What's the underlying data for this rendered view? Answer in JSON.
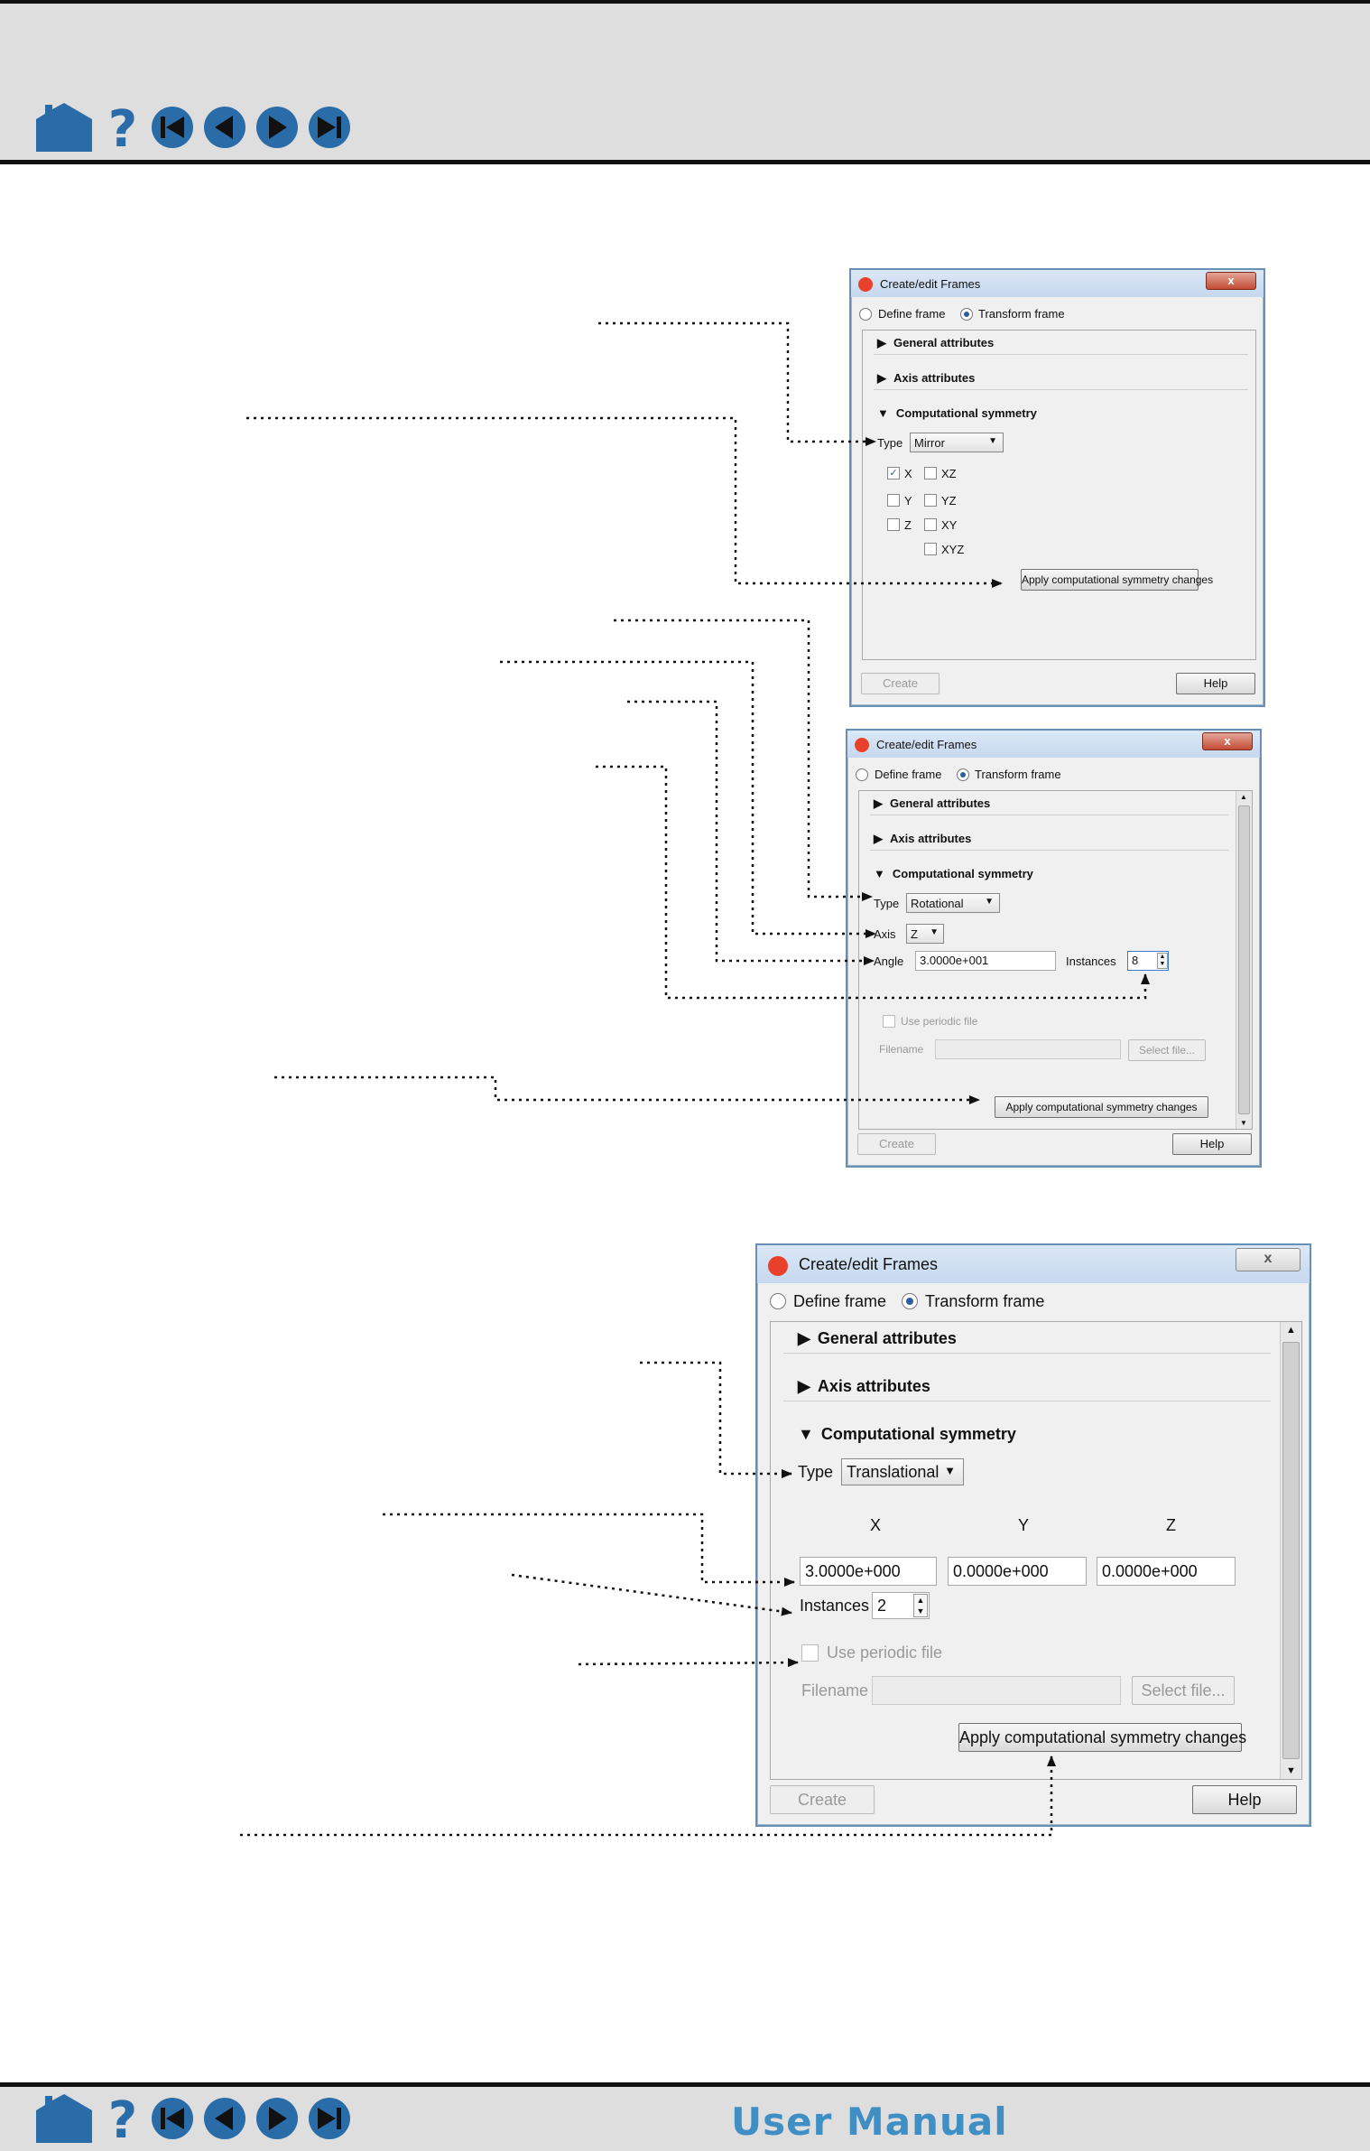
{
  "footer": {
    "title": "User Manual"
  },
  "dialog_mirror": {
    "title": "Create/edit Frames",
    "close": "x",
    "radio_define": "Define frame",
    "radio_transform": "Transform frame",
    "sec_general": "General attributes",
    "sec_axis": "Axis attributes",
    "sec_comp": "Computational symmetry",
    "type_label": "Type",
    "type_value": "Mirror",
    "checks": {
      "x": "X",
      "y": "Y",
      "z": "Z",
      "xz": "XZ",
      "yz": "YZ",
      "xy": "XY",
      "xyz": "XYZ"
    },
    "apply": "Apply computational symmetry changes",
    "create": "Create",
    "help": "Help"
  },
  "dialog_rot": {
    "title": "Create/edit Frames",
    "close": "x",
    "radio_define": "Define frame",
    "radio_transform": "Transform frame",
    "sec_general": "General attributes",
    "sec_axis": "Axis attributes",
    "sec_comp": "Computational symmetry",
    "type_label": "Type",
    "type_value": "Rotational",
    "axis_label": "Axis",
    "axis_value": "Z",
    "angle_label": "Angle",
    "angle_value": "3.0000e+001",
    "instances_label": "Instances",
    "instances_value": "8",
    "periodic": "Use periodic file",
    "filename_label": "Filename",
    "select_file": "Select file...",
    "apply": "Apply computational symmetry changes",
    "create": "Create",
    "help": "Help"
  },
  "dialog_trans": {
    "title": "Create/edit Frames",
    "close": "x",
    "radio_define": "Define frame",
    "radio_transform": "Transform frame",
    "sec_general": "General attributes",
    "sec_axis": "Axis attributes",
    "sec_comp": "Computational symmetry",
    "type_label": "Type",
    "type_value": "Translational",
    "col_x": "X",
    "col_y": "Y",
    "col_z": "Z",
    "val_x": "3.0000e+000",
    "val_y": "0.0000e+000",
    "val_z": "0.0000e+000",
    "instances_label": "Instances",
    "instances_value": "2",
    "periodic": "Use periodic file",
    "filename_label": "Filename",
    "select_file": "Select file...",
    "apply": "Apply computational symmetry changes",
    "create": "Create",
    "help": "Help"
  },
  "icons": [
    "home-icon",
    "help-icon",
    "first-page-icon",
    "previous-page-icon",
    "next-page-icon",
    "last-page-icon"
  ],
  "colors": {
    "nav_blue": "#2a6ca8",
    "band_gray": "#dedede",
    "title_blue": "#3f8fc4"
  }
}
